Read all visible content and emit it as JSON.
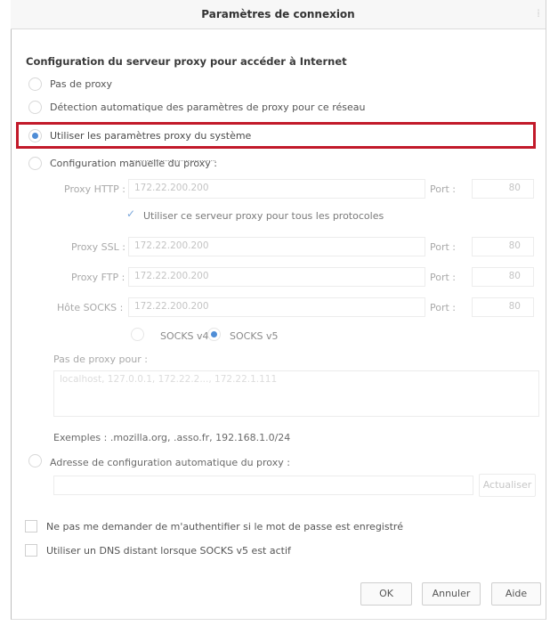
{
  "window": {
    "title": "Paramètres de connexion"
  },
  "section_title": "Configuration du serveur proxy pour accéder à Internet",
  "proxy_modes": [
    {
      "label": "Pas de proxy",
      "checked": false
    },
    {
      "label": "Détection automatique des paramètres de proxy pour ce réseau",
      "checked": false
    },
    {
      "label": "Utiliser les paramètres proxy du système",
      "checked": true
    },
    {
      "label": "Configuration manuelle du proxy :",
      "checked": false
    }
  ],
  "manual": {
    "http_label": "Proxy HTTP :",
    "http_value": "172.22.200.200",
    "port_label": "Port :",
    "http_port": "80",
    "share_label": "Utiliser ce serveur proxy pour tous les protocoles",
    "ssl_label": "Proxy SSL :",
    "ssl_value": "172.22.200.200",
    "ssl_port": "80",
    "ftp_label": "Proxy FTP :",
    "ftp_value": "172.22.200.200",
    "ftp_port": "80",
    "socks_label": "Hôte SOCKS :",
    "socks_value": "172.22.200.200",
    "socks_port": "80",
    "socks_v4": "SOCKS v4",
    "socks_v5": "SOCKS v5"
  },
  "no_proxy": {
    "label": "Pas de proxy pour :",
    "value": "localhost, 127.0.0.1, 172.22.2..., 172.22.1.111",
    "examples": "Exemples : .mozilla.org, .asso.fr, 192.168.1.0/24"
  },
  "auto_config": {
    "label": "Adresse de configuration automatique du proxy :",
    "value": "",
    "reload_button": "Actualiser"
  },
  "checkboxes": [
    {
      "label": "Ne pas me demander de m'authentifier si le mot de passe est enregistré",
      "checked": false
    },
    {
      "label": "Utiliser un DNS distant lorsque SOCKS v5 est actif",
      "checked": false
    }
  ],
  "buttons": {
    "ok": "OK",
    "cancel": "Annuler",
    "help": "Aide"
  },
  "colors": {
    "highlight": "#c21a2a",
    "radio_selected": "#4f8dd6"
  }
}
